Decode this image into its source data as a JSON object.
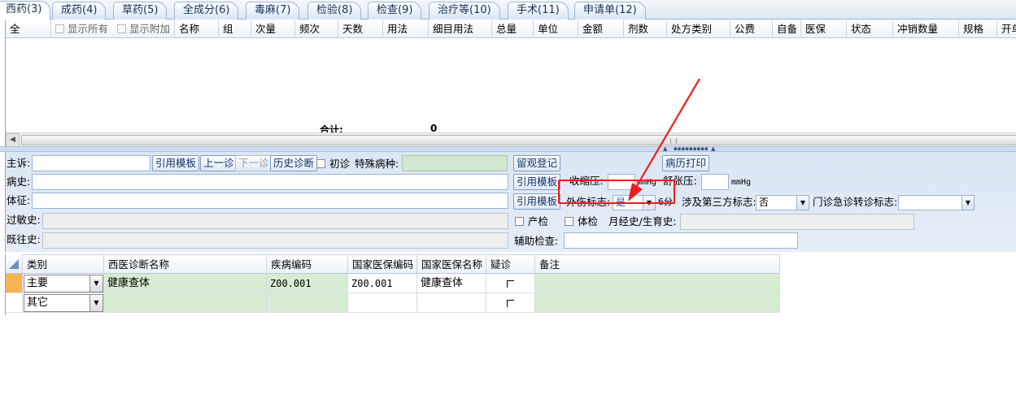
{
  "tabs": [
    {
      "label": "西药(3)"
    },
    {
      "label": "成药(4)"
    },
    {
      "label": "草药(5)"
    },
    {
      "label": "全成分(6)"
    },
    {
      "label": "毒麻(7)"
    },
    {
      "label": "检验(8)"
    },
    {
      "label": "检查(9)"
    },
    {
      "label": "治疗等(10)"
    },
    {
      "label": "手术(11)"
    },
    {
      "label": "申请单(12)"
    }
  ],
  "rx_grid": {
    "col_all": "全",
    "show_all": "显示所有",
    "show_extra": "显示附加",
    "columns": [
      "名称",
      "组",
      "次量",
      "频次",
      "天数",
      "用法",
      "细目用法",
      "总量",
      "单位",
      "金额",
      "剂数",
      "处方类别",
      "公费",
      "自备",
      "医保",
      "状态",
      "冲销数量",
      "规格",
      "开单"
    ],
    "total_label": "合计:",
    "total_value": "0"
  },
  "form": {
    "chief_complaint_label": "主诉:",
    "cite_template": "引用模板",
    "prev_visit": "上一诊",
    "next_visit": "下一诊",
    "history_diag": "历史诊断",
    "first_visit": "初诊",
    "special_disease_label": "特殊病种:",
    "observation_register": "留观登记",
    "print_record": "病历打印",
    "history_label": "病史:",
    "systolic_label": "收缩压:",
    "diastolic_label": "舒张压:",
    "unit_mmhg": "mmHg",
    "signs_label": "体征:",
    "trauma_flag_label": "外伤标志:",
    "trauma_flag_value": "是",
    "score_suffix": "6分",
    "third_party_label": "涉及第三方标志:",
    "third_party_value": "否",
    "transfer_label": "门诊急诊转诊标志:",
    "transfer_value": "",
    "allergy_label": "过敏史:",
    "prenatal": "产检",
    "physical_exam": "体检",
    "menstrual_label": "月经史/生育史:",
    "past_history_label": "既往史:",
    "aux_exam_label": "辅助检查:"
  },
  "diag_grid": {
    "columns": [
      "类别",
      "西医诊断名称",
      "疾病编码",
      "国家医保编码",
      "国家医保名称",
      "疑诊",
      "备注"
    ],
    "rows": [
      {
        "category": "主要",
        "name": "健康查体",
        "code": "Z00.001",
        "ins_code": "Z00.001",
        "ins_name": "健康查体"
      },
      {
        "category": "其它",
        "name": "",
        "code": "",
        "ins_code": "",
        "ins_name": ""
      }
    ]
  },
  "colors": {
    "annotation": "#ee1b1b",
    "tab_text": "#16325c",
    "panel_bg": "#dbe6f4",
    "row_green": "#d7ecd2",
    "current_row": "#f7b552"
  }
}
